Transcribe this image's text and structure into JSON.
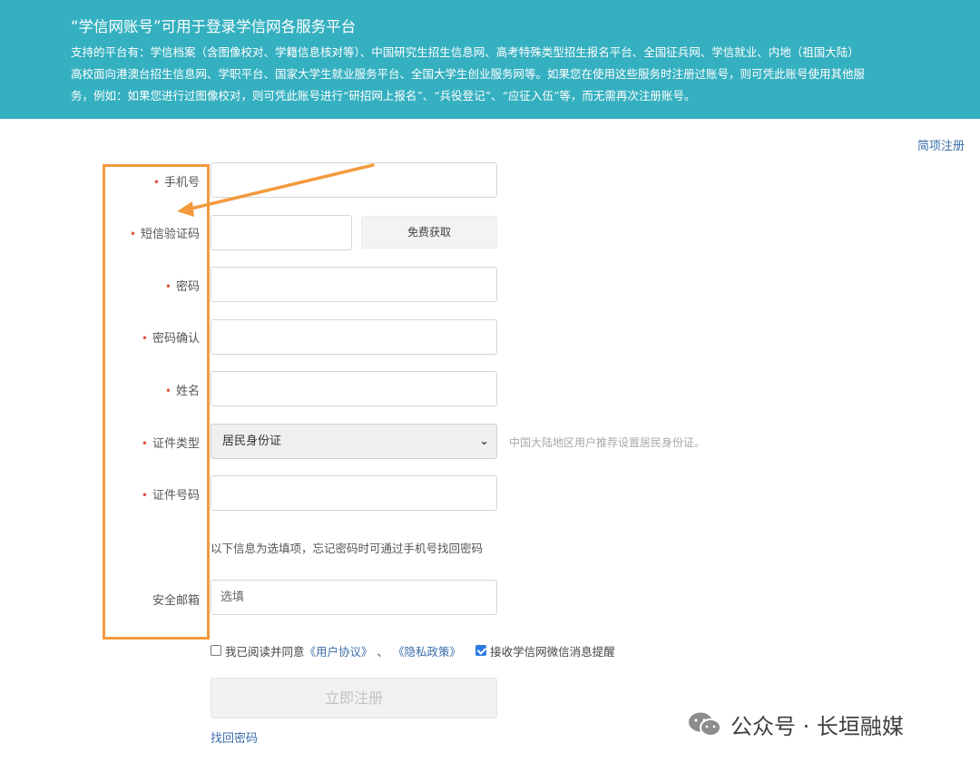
{
  "banner": {
    "title": "“学信网账号”可用于登录学信网各服务平台",
    "description_lines": [
      "支持的平台有：学信档案（含图像校对、学籍信息核对等）、中国研究生招生信息网、高考特殊类型招生报名平台、全国征兵网、学信就业、内地（祖国大陆）",
      "高校面向港澳台招生信息网、学职平台、国家大学生就业服务平台、全国大学生创业服务网等。如果您在使用这些服务时注册过账号，则可凭此账号使用其他服",
      "务，例如：如果您进行过图像校对，则可凭此账号进行“研招网上报名”、“兵役登记”、“应征入伍”等，而无需再次注册账号。"
    ]
  },
  "simple_register_link": "简项注册",
  "form": {
    "required_mark": "•",
    "labels": {
      "phone": "手机号",
      "sms_code": "短信验证码",
      "password": "密码",
      "password_confirm": "密码确认",
      "name": "姓名",
      "id_type": "证件类型",
      "id_number": "证件号码",
      "email": "安全邮箱"
    },
    "sms_button": "免费获取",
    "id_type_selected": "居民身份证",
    "id_type_hint": "中国大陆地区用户推荐设置居民身份证。",
    "optional_note": "以下信息为选填项，忘记密码时可通过手机号找回密码",
    "email_placeholder": "选填",
    "agree_text": "我已阅读并同意",
    "user_agreement": "《用户协议》",
    "separator": "、",
    "privacy_policy": "《隐私政策》",
    "wechat_notify": "接收学信网微信消息提醒",
    "agree_checked": false,
    "wechat_checked": true,
    "submit": "立即注册",
    "find_password": "找回密码"
  },
  "annotation": {
    "color": "#f39a3e"
  },
  "watermark": "公众号 · 长垣融媒"
}
